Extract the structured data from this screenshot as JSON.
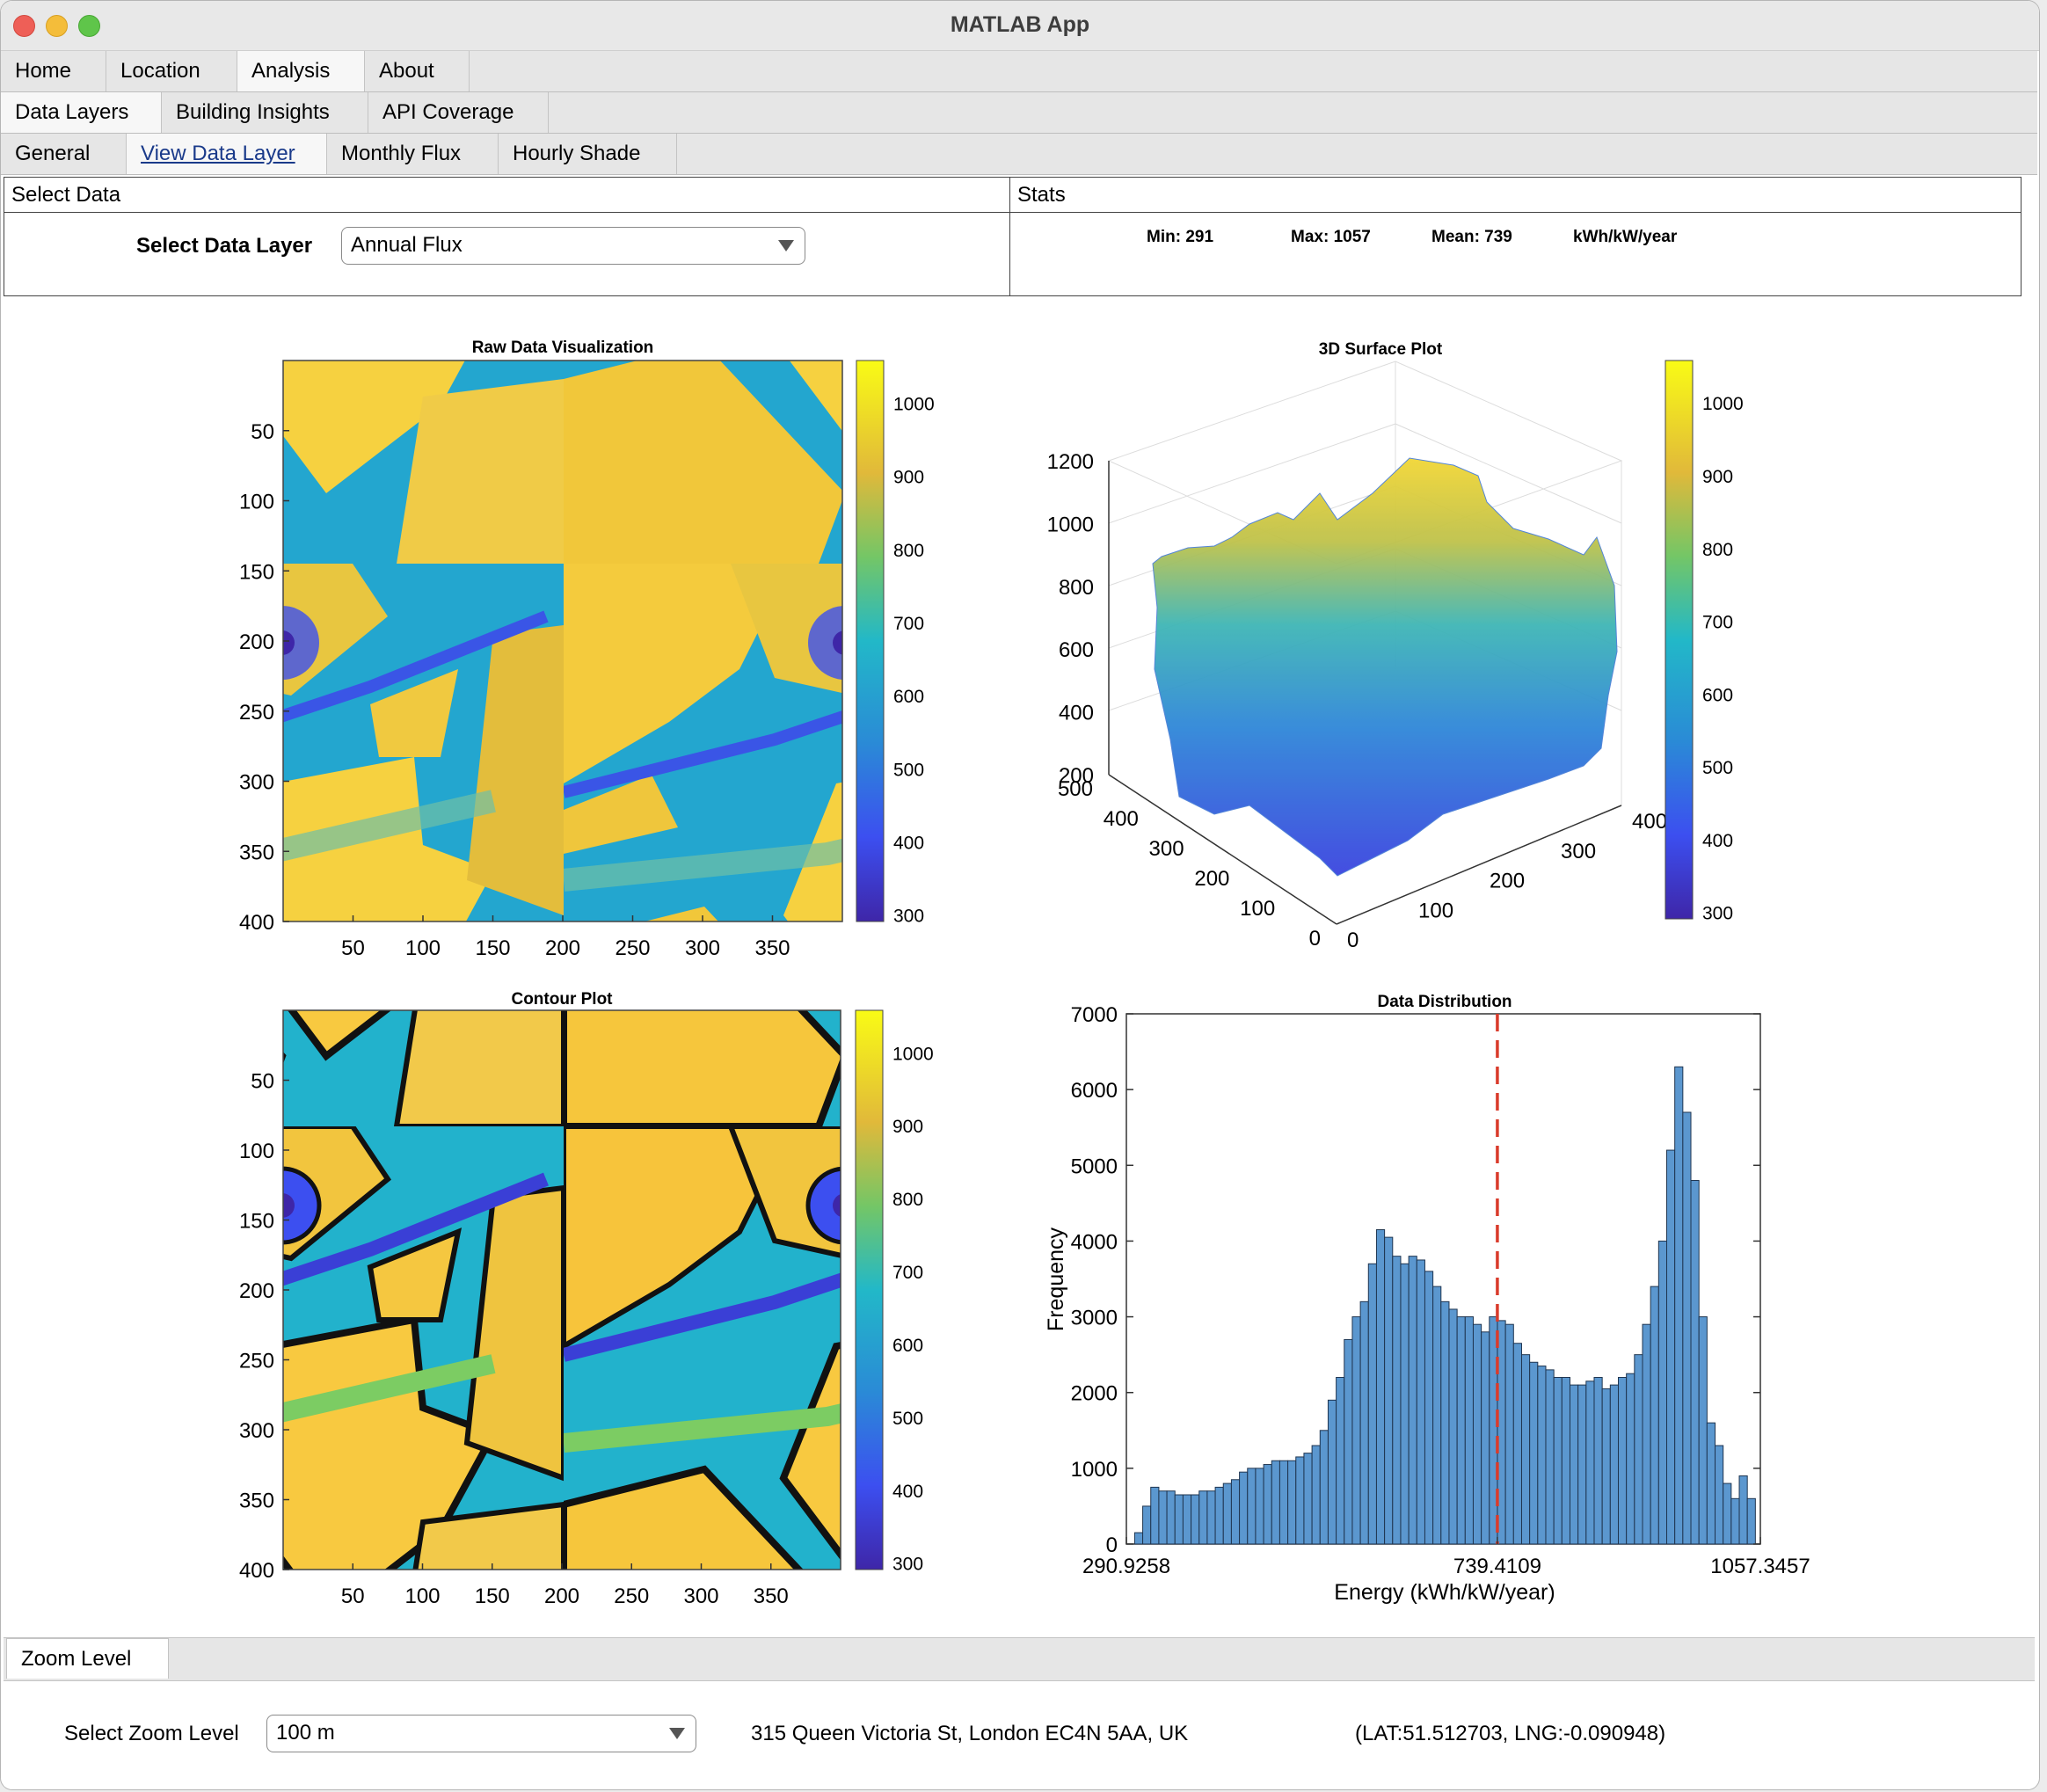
{
  "window": {
    "title": "MATLAB App"
  },
  "tabs_level1": [
    {
      "label": "Home"
    },
    {
      "label": "Location"
    },
    {
      "label": "Analysis"
    },
    {
      "label": "About"
    }
  ],
  "tabs_level2": [
    {
      "label": "Data Layers"
    },
    {
      "label": "Building Insights"
    },
    {
      "label": "API Coverage"
    }
  ],
  "tabs_level3": [
    {
      "label": "General"
    },
    {
      "label": "View Data Layer"
    },
    {
      "label": "Monthly Flux"
    },
    {
      "label": "Hourly Shade"
    }
  ],
  "select_panel": {
    "title": "Select Data",
    "label": "Select Data Layer",
    "value": "Annual Flux"
  },
  "stats_panel": {
    "title": "Stats",
    "min": "Min: 291",
    "max": "Max: 1057",
    "mean": "Mean: 739",
    "unit": "kWh/kW/year"
  },
  "zoom_panel": {
    "tab": "Zoom Level",
    "label": "Select Zoom Level",
    "value": "100 m",
    "address": "315 Queen Victoria St, London EC4N 5AA, UK",
    "coords": "(LAT:51.512703, LNG:-0.090948)"
  },
  "colors": {
    "parula_low": "#3e26a8",
    "parula_mid": "#22b8c8",
    "parula_high": "#f9fb15",
    "hist_bar": "#5b97cf",
    "mean_line": "#d93b2b"
  },
  "chart_data": [
    {
      "type": "heatmap",
      "title": "Raw Data Visualization",
      "x_ticks": [
        "50",
        "100",
        "150",
        "200",
        "250",
        "300",
        "350"
      ],
      "y_ticks": [
        "50",
        "100",
        "150",
        "200",
        "250",
        "300",
        "350",
        "400"
      ],
      "colorbar_ticks": [
        "1000",
        "900",
        "800",
        "700",
        "600",
        "500",
        "400",
        "300"
      ]
    },
    {
      "type": "area",
      "title": "3D Surface Plot",
      "z_ticks": [
        "1200",
        "1000",
        "800",
        "600",
        "400",
        "200"
      ],
      "y_ticks": [
        "500",
        "400",
        "300",
        "200",
        "100",
        "0"
      ],
      "x_ticks": [
        "0",
        "100",
        "200",
        "300",
        "400"
      ],
      "colorbar_ticks": [
        "1000",
        "900",
        "800",
        "700",
        "600",
        "500",
        "400",
        "300"
      ]
    },
    {
      "type": "heatmap",
      "title": "Contour Plot",
      "x_ticks": [
        "50",
        "100",
        "150",
        "200",
        "250",
        "300",
        "350"
      ],
      "y_ticks": [
        "50",
        "100",
        "150",
        "200",
        "250",
        "300",
        "350",
        "400"
      ],
      "colorbar_ticks": [
        "1000",
        "900",
        "800",
        "700",
        "600",
        "500",
        "400",
        "300"
      ]
    },
    {
      "type": "bar",
      "title": "Data Distribution",
      "xlabel": "Energy (kWh/kW/year)",
      "ylabel": "Frequency",
      "x_tick_labels": [
        "290.9258",
        "739.4109",
        "1057.3457"
      ],
      "y_ticks": [
        "0",
        "1000",
        "2000",
        "3000",
        "4000",
        "5000",
        "6000",
        "7000"
      ],
      "ylim": [
        0,
        7000
      ],
      "xlim": [
        290.9258,
        1057.3457
      ],
      "mean": 739.4109,
      "values": [
        150,
        500,
        750,
        700,
        700,
        650,
        650,
        650,
        700,
        700,
        750,
        800,
        850,
        950,
        1000,
        1000,
        1050,
        1100,
        1100,
        1100,
        1150,
        1200,
        1300,
        1500,
        1900,
        2200,
        2700,
        3000,
        3200,
        3700,
        4150,
        4050,
        3800,
        3700,
        3800,
        3750,
        3600,
        3400,
        3200,
        3100,
        3000,
        3000,
        2900,
        2800,
        3000,
        2950,
        2900,
        2650,
        2500,
        2400,
        2350,
        2300,
        2200,
        2200,
        2100,
        2100,
        2150,
        2200,
        2050,
        2100,
        2200,
        2250,
        2500,
        2900,
        3400,
        4000,
        5200,
        6300,
        5700,
        4800,
        3000,
        1600,
        1300,
        800,
        600,
        900,
        600
      ]
    }
  ]
}
